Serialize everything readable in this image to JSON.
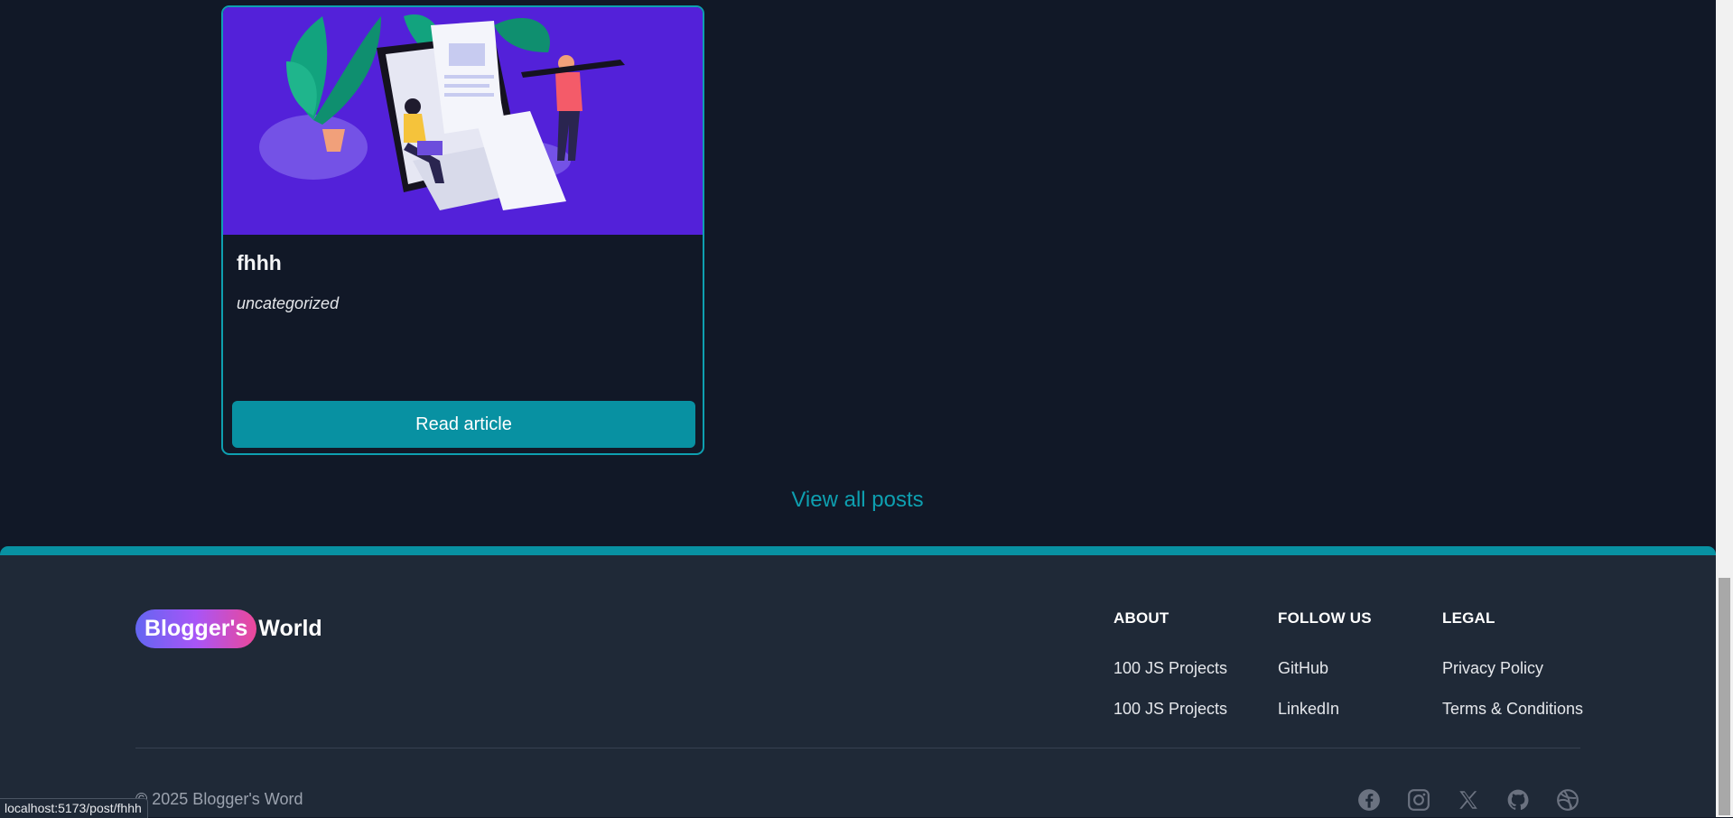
{
  "post": {
    "title": "fhhh",
    "category": "uncategorized",
    "read_label": "Read article"
  },
  "view_all_label": "View all posts",
  "footer": {
    "brand_pill": "Blogger's",
    "brand_rest": "World",
    "columns": [
      {
        "heading": "ABOUT",
        "links": [
          "100 JS Projects",
          "100 JS Projects"
        ]
      },
      {
        "heading": "FOLLOW US",
        "links": [
          "GitHub",
          "LinkedIn"
        ]
      },
      {
        "heading": "LEGAL",
        "links": [
          "Privacy Policy",
          "Terms & Conditions"
        ]
      }
    ],
    "copyright": "© 2025 Blogger's Word",
    "socials": [
      "facebook-icon",
      "instagram-icon",
      "x-icon",
      "github-icon",
      "dribbble-icon"
    ]
  },
  "status_url": "localhost:5173/post/fhhh",
  "colors": {
    "accent": "#0891a2",
    "background": "#111827",
    "footer": "#1f2937",
    "hero": "#5321d9"
  }
}
